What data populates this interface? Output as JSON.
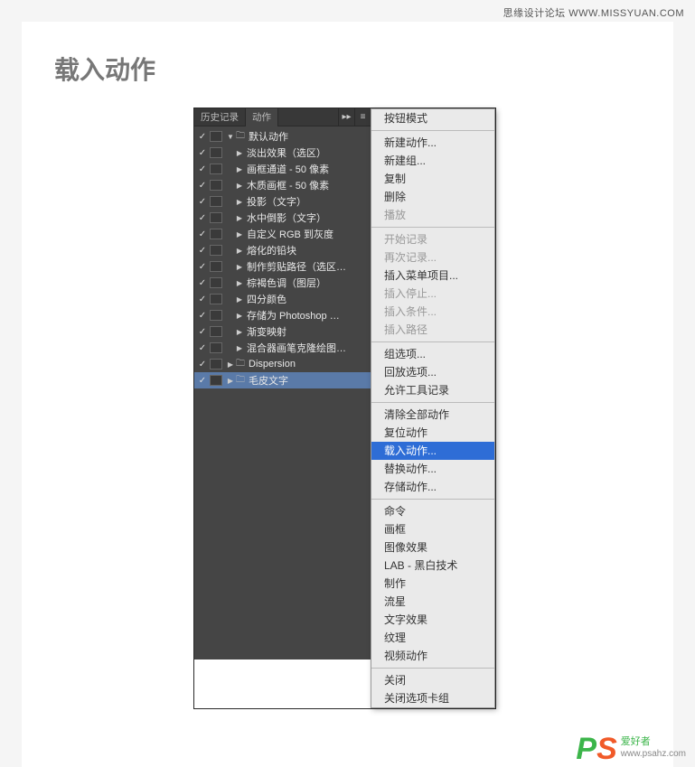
{
  "watermark": "思缘设计论坛  WWW.MISSYUAN.COM",
  "title": "载入动作",
  "tabs": {
    "history": "历史记录",
    "actions": "动作",
    "flyout": "▸▸"
  },
  "rows": [
    {
      "chk": "✓",
      "indent": "set",
      "exp": "▼",
      "ico": "folder",
      "label": "默认动作",
      "sel": false
    },
    {
      "chk": "✓",
      "indent": "1",
      "exp": "▶",
      "ico": "",
      "label": "淡出效果（选区）",
      "sel": false
    },
    {
      "chk": "✓",
      "indent": "1",
      "exp": "▶",
      "ico": "",
      "label": "画框通道 - 50 像素",
      "sel": false
    },
    {
      "chk": "✓",
      "indent": "1",
      "exp": "▶",
      "ico": "",
      "label": "木质画框 - 50 像素",
      "sel": false
    },
    {
      "chk": "✓",
      "indent": "1",
      "exp": "▶",
      "ico": "",
      "label": "投影（文字）",
      "sel": false
    },
    {
      "chk": "✓",
      "indent": "1",
      "exp": "▶",
      "ico": "",
      "label": "水中倒影（文字）",
      "sel": false
    },
    {
      "chk": "✓",
      "indent": "1",
      "exp": "▶",
      "ico": "",
      "label": "自定义 RGB 到灰度",
      "sel": false
    },
    {
      "chk": "✓",
      "indent": "1",
      "exp": "▶",
      "ico": "",
      "label": "熔化的铅块",
      "sel": false
    },
    {
      "chk": "✓",
      "indent": "1",
      "exp": "▶",
      "ico": "",
      "label": "制作剪贴路径（选区…",
      "sel": false
    },
    {
      "chk": "✓",
      "indent": "1",
      "exp": "▶",
      "ico": "",
      "label": "棕褐色调（图层）",
      "sel": false
    },
    {
      "chk": "✓",
      "indent": "1",
      "exp": "▶",
      "ico": "",
      "label": "四分颜色",
      "sel": false
    },
    {
      "chk": "✓",
      "indent": "1",
      "exp": "▶",
      "ico": "",
      "label": "存储为 Photoshop …",
      "sel": false
    },
    {
      "chk": "✓",
      "indent": "1",
      "exp": "▶",
      "ico": "",
      "label": "渐变映射",
      "sel": false
    },
    {
      "chk": "✓",
      "indent": "1",
      "exp": "▶",
      "ico": "",
      "label": "混合器画笔克隆绘图…",
      "sel": false
    },
    {
      "chk": "✓",
      "indent": "set",
      "exp": "▶",
      "ico": "folder",
      "label": "Dispersion",
      "sel": false
    },
    {
      "chk": "✓",
      "indent": "set",
      "exp": "▶",
      "ico": "folder",
      "label": "毛皮文字",
      "sel": true
    }
  ],
  "menu": [
    {
      "t": "按钮模式",
      "s": false
    },
    {
      "sep": true
    },
    {
      "t": "新建动作...",
      "s": false
    },
    {
      "t": "新建组...",
      "s": false
    },
    {
      "t": "复制",
      "s": false
    },
    {
      "t": "删除",
      "s": false
    },
    {
      "t": "播放",
      "s": false,
      "d": true
    },
    {
      "sep": true
    },
    {
      "t": "开始记录",
      "s": false,
      "d": true
    },
    {
      "t": "再次记录...",
      "s": false,
      "d": true
    },
    {
      "t": "插入菜单项目...",
      "s": false
    },
    {
      "t": "插入停止...",
      "s": false,
      "d": true
    },
    {
      "t": "插入条件...",
      "s": false,
      "d": true
    },
    {
      "t": "插入路径",
      "s": false,
      "d": true
    },
    {
      "sep": true
    },
    {
      "t": "组选项...",
      "s": false
    },
    {
      "t": "回放选项...",
      "s": false
    },
    {
      "t": "允许工具记录",
      "s": false
    },
    {
      "sep": true
    },
    {
      "t": "清除全部动作",
      "s": false
    },
    {
      "t": "复位动作",
      "s": false
    },
    {
      "t": "载入动作...",
      "s": true
    },
    {
      "t": "替换动作...",
      "s": false
    },
    {
      "t": "存储动作...",
      "s": false
    },
    {
      "sep": true
    },
    {
      "t": "命令",
      "s": false
    },
    {
      "t": "画框",
      "s": false
    },
    {
      "t": "图像效果",
      "s": false
    },
    {
      "t": "LAB - 黑白技术",
      "s": false
    },
    {
      "t": "制作",
      "s": false
    },
    {
      "t": "流星",
      "s": false
    },
    {
      "t": "文字效果",
      "s": false
    },
    {
      "t": "纹理",
      "s": false
    },
    {
      "t": "视频动作",
      "s": false
    },
    {
      "sep": true
    },
    {
      "t": "关闭",
      "s": false
    },
    {
      "t": "关闭选项卡组",
      "s": false
    }
  ],
  "logo": {
    "cn": "爱好者",
    "url": "www.psahz.com"
  }
}
